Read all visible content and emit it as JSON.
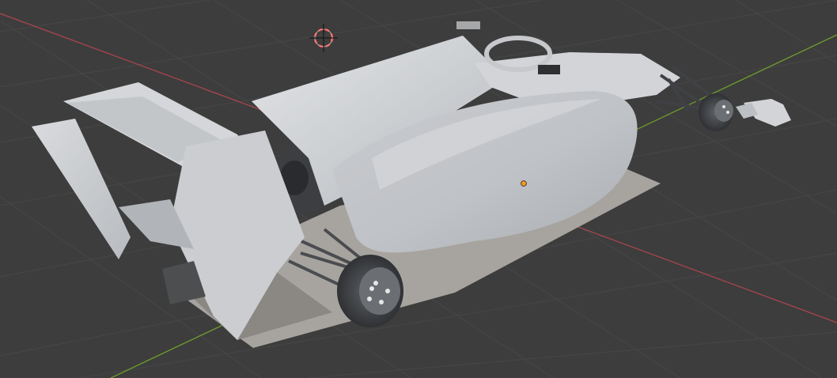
{
  "viewport": {
    "mode": "3d-viewport-solid-shading",
    "background_color": "#3d3d3d",
    "grid_color": "#4a4a4a",
    "axis_x_color": "#a8454f",
    "axis_y_color": "#6f9b2b",
    "object_origin_color": "#f29a1c"
  },
  "scene": {
    "object": {
      "name_visible": false,
      "model_type": "formula-race-car",
      "surface_color": "#c8cacd"
    },
    "cursor": {
      "icon": "3d-cursor-icon"
    }
  }
}
